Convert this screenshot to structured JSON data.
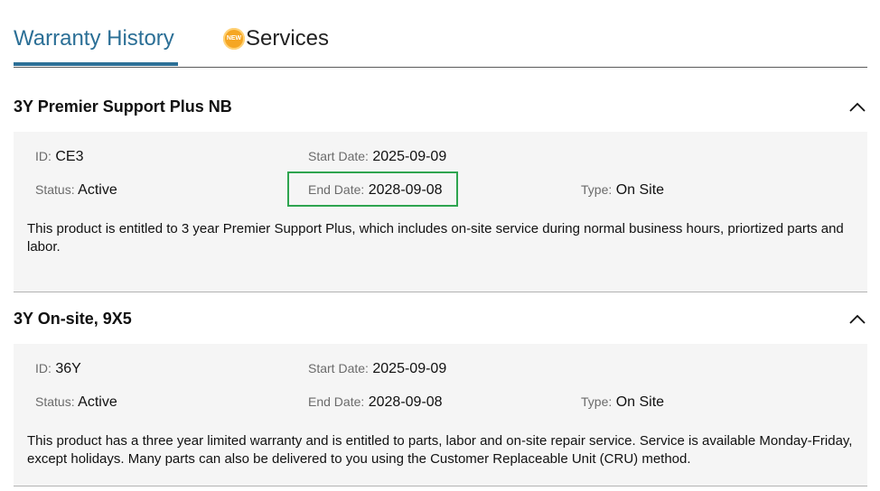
{
  "tabs": {
    "warranty_history": "Warranty History",
    "services_badge": "NEW",
    "services": "Services"
  },
  "colors": {
    "accent": "#2b6f96",
    "highlight": "#2ea44f",
    "badge": "#f5a623"
  },
  "icons": {
    "collapse": "chevron-up-icon"
  },
  "warranties": [
    {
      "title": "3Y Premier Support Plus NB",
      "id_label": "ID",
      "id": "CE3",
      "start_label": "Start Date",
      "start": "2025-09-09",
      "status_label": "Status",
      "status": "Active",
      "end_label": "End Date",
      "end": "2028-09-08",
      "type_label": "Type",
      "type": "On Site",
      "description": "This product is entitled to 3 year Premier Support Plus, which includes on-site service during normal business hours, priortized parts and labor."
    },
    {
      "title": "3Y On-site, 9X5",
      "id_label": "ID",
      "id": "36Y",
      "start_label": "Start Date",
      "start": "2025-09-09",
      "status_label": "Status",
      "status": "Active",
      "end_label": "End Date",
      "end": "2028-09-08",
      "type_label": "Type",
      "type": "On Site",
      "description": "This product has a three year limited warranty and is entitled to parts, labor and on-site repair service. Service is available Monday-Friday, except holidays. Many parts can also be delivered to you using the Customer Replaceable Unit (CRU) method."
    }
  ]
}
